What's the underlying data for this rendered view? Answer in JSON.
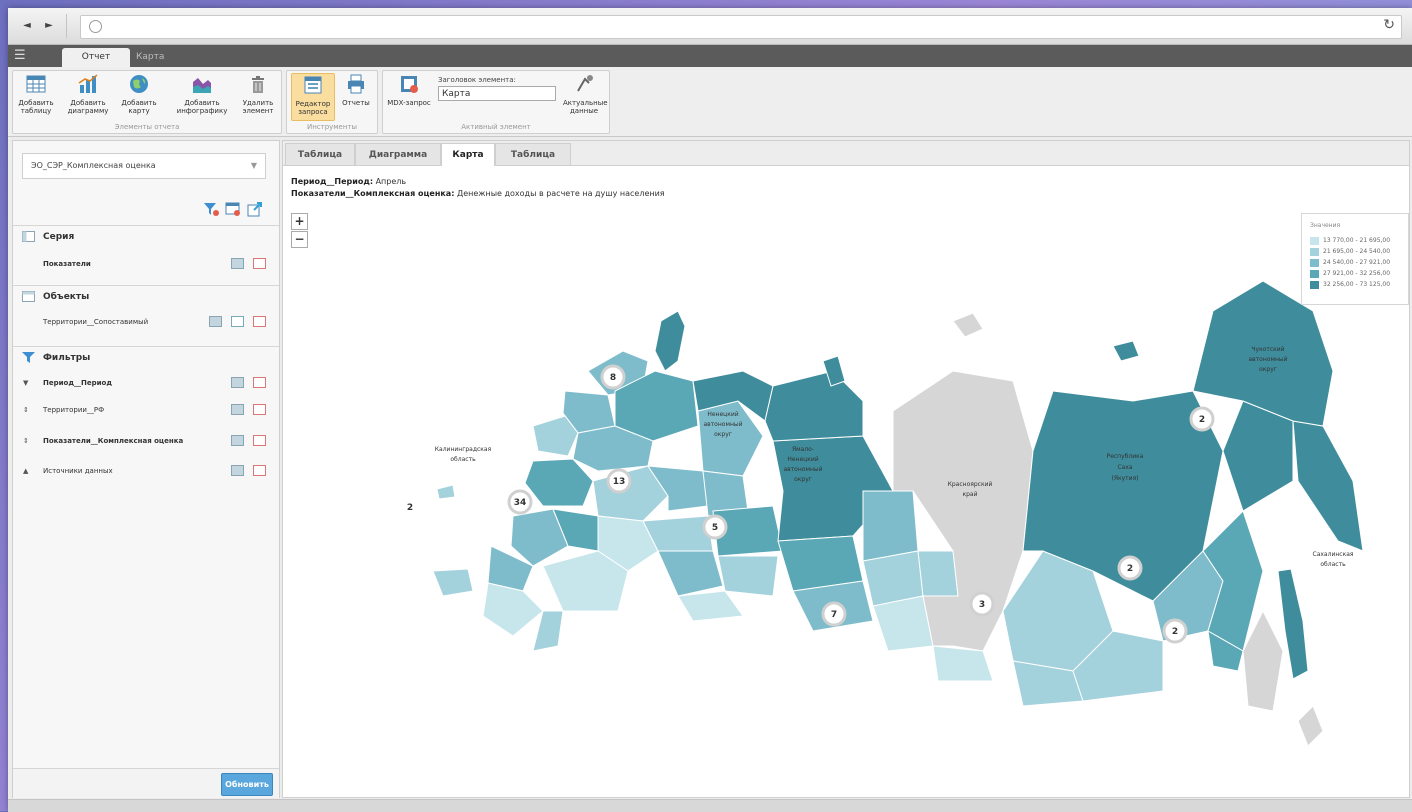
{
  "colors": {
    "c1": "#c6e6ec",
    "c2": "#a3d1dc",
    "c3": "#7fbccb",
    "c4": "#5aa7b5",
    "c5": "#3f8d9c",
    "nodata": "#d6d6d6",
    "accent": "#5aa7dd"
  },
  "browser": {
    "back": "◄",
    "forward": "►",
    "reload": "↻"
  },
  "top_tabs": [
    "Отчет",
    "Карта"
  ],
  "ribbon": {
    "report_elements": {
      "label": "Элементы отчета",
      "add_table": "Добавить таблицу",
      "add_chart": "Добавить диаграмму",
      "add_map": "Добавить карту",
      "add_infographic": "Добавить инфографику",
      "delete_element": "Удалить элемент"
    },
    "tools": {
      "label": "Инструменты",
      "query_editor": "Редактор запроса",
      "reports": "Отчеты"
    },
    "active_element": {
      "label": "Активный элемент",
      "mdx_query": "MDX-запрос",
      "title_caption": "Заголовок элемента:",
      "title_value": "Карта",
      "actual_data": "Актуальные данные"
    }
  },
  "left_panel": {
    "source_select": "ЭО_СЭР_Комплексная оценка",
    "series": {
      "title": "Серия",
      "items": [
        "Показатели"
      ]
    },
    "objects": {
      "title": "Объекты",
      "items": [
        "Территории__Сопоставимый"
      ]
    },
    "filters": {
      "title": "Фильтры",
      "items": [
        {
          "arrow": "▼",
          "label": "Период__Период",
          "bold": true
        },
        {
          "arrow": "⇕",
          "label": "Территории__РФ",
          "bold": false
        },
        {
          "arrow": "⇕",
          "label": "Показатели__Комплексная оценка",
          "bold": true
        },
        {
          "arrow": "▲",
          "label": "Источники данных",
          "bold": false
        }
      ]
    },
    "update_button": "Обновить"
  },
  "main_tabs": [
    "Таблица",
    "Диаграмма",
    "Карта",
    "Таблица"
  ],
  "info": {
    "period_label": "Период__Период:",
    "period_value": "Апрель",
    "indicator_label": "Показатели__Комплексная оценка:",
    "indicator_value": "Денежные доходы в расчете на душу населения"
  },
  "zoom": {
    "in": "+",
    "out": "−"
  },
  "legend": {
    "title": "Значения",
    "items": [
      "13 770,00 - 21 695,00",
      "21 695,00 - 24 540,00",
      "24 540,00 - 27 921,00",
      "27 921,00 - 32 256,00",
      "32 256,00 - 73 125,00"
    ]
  },
  "map_labels": {
    "kaliningrad": [
      "Калининградская",
      "область"
    ],
    "nenets": [
      "Ненецкий",
      "автономный",
      "округ"
    ],
    "yamal": [
      "Ямало-",
      "Ненецкий",
      "автономный",
      "округ"
    ],
    "krasnoyarsk": [
      "Красноярский",
      "край"
    ],
    "sakha": [
      "Республика",
      "Саха",
      "(Якутия)"
    ],
    "chukotka": [
      "Чукотский",
      "автономный",
      "округ"
    ],
    "sakhalin": [
      "Сахалинская",
      "область"
    ]
  },
  "clusters": [
    "8",
    "13",
    "34",
    "5",
    "7",
    "3",
    "2",
    "2",
    "2",
    "2"
  ],
  "map_outside_label": "2"
}
